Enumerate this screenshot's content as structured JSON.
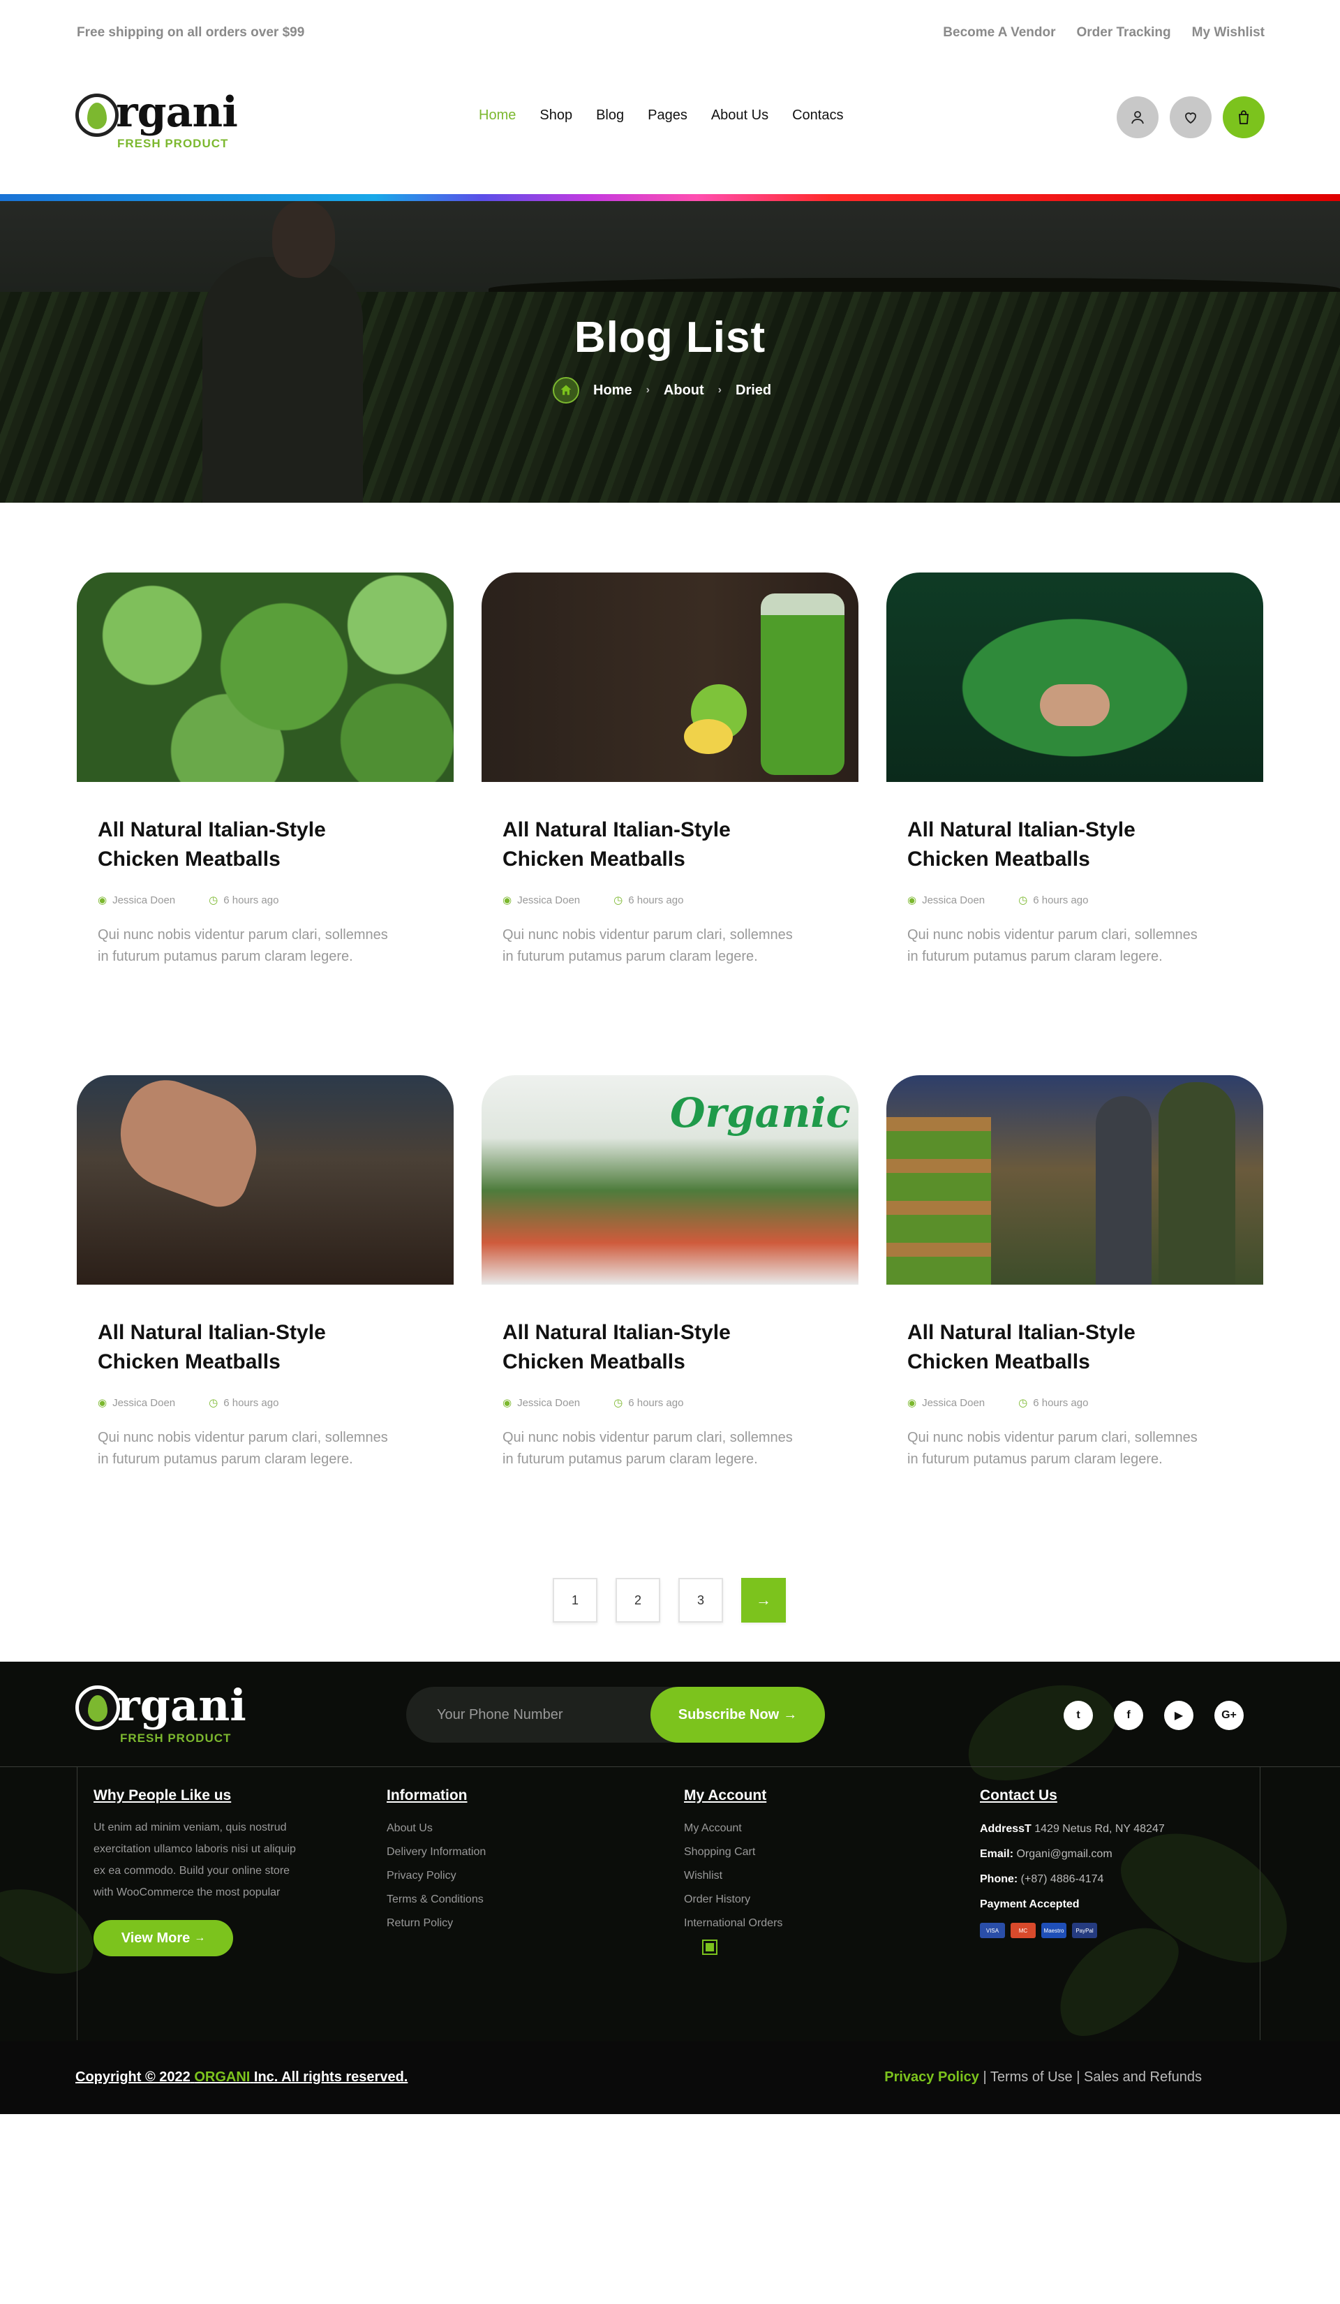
{
  "topbar": {
    "promo": "Free shipping on all orders over $99",
    "links": [
      "Become A Vendor",
      "Order Tracking",
      "My Wishlist"
    ]
  },
  "brand": {
    "name": "rgani",
    "first_letter": "O",
    "tagline": "FRESH PRODUCT"
  },
  "nav": {
    "items": [
      "Home",
      "Shop",
      "Blog",
      "Pages",
      "About Us",
      "Contacs"
    ],
    "active": "Home"
  },
  "header_icons": [
    "user-icon",
    "heart-icon",
    "shopping-bag-icon"
  ],
  "hero": {
    "title": "Blog List",
    "breadcrumb": [
      "Home",
      "About",
      "Dried"
    ]
  },
  "posts": [
    {
      "title": "All Natural Italian-Style Chicken Meatballs",
      "author": "Jessica Doen",
      "time": "6 hours ago",
      "excerpt": "Qui nunc nobis videntur parum clari, sollemnes in futurum putamus parum claram legere."
    },
    {
      "title": "All Natural Italian-Style Chicken Meatballs",
      "author": "Jessica Doen",
      "time": "6 hours ago",
      "excerpt": "Qui nunc nobis videntur parum clari, sollemnes in futurum putamus parum claram legere."
    },
    {
      "title": "All Natural Italian-Style Chicken Meatballs",
      "author": "Jessica Doen",
      "time": "6 hours ago",
      "excerpt": "Qui nunc nobis videntur parum clari, sollemnes in futurum putamus parum claram legere."
    },
    {
      "title": "All Natural Italian-Style Chicken Meatballs",
      "author": "Jessica Doen",
      "time": "6 hours ago",
      "excerpt": "Qui nunc nobis videntur parum clari, sollemnes in futurum putamus parum claram legere."
    },
    {
      "title": "All Natural Italian-Style Chicken Meatballs",
      "author": "Jessica Doen",
      "time": "6 hours ago",
      "excerpt": "Qui nunc nobis videntur parum clari, sollemnes in futurum putamus parum claram legere."
    },
    {
      "title": "All Natural Italian-Style Chicken Meatballs",
      "author": "Jessica Doen",
      "time": "6 hours ago",
      "excerpt": "Qui nunc nobis videntur parum clari, sollemnes in futurum putamus parum claram legere."
    }
  ],
  "post_images": [
    "mint-leaves-photo",
    "green-smoothie-photo",
    "spinach-bunch-photo",
    "soil-seeding-photo",
    "organic-supermarket-photo",
    "warehouse-workers-photo"
  ],
  "organic_sign": "Organic",
  "pagination": {
    "pages": [
      "1",
      "2",
      "3"
    ],
    "next": "→"
  },
  "footer": {
    "subscribe": {
      "placeholder": "Your Phone Number",
      "button": "Subscribe Now"
    },
    "social": [
      "twitter-icon",
      "facebook-icon",
      "youtube-icon",
      "google-plus-icon"
    ],
    "social_glyphs": [
      "t",
      "f",
      "▶",
      "G+"
    ],
    "why": {
      "heading": "Why People Like us",
      "text": "Ut enim ad minim veniam, quis nostrud exercitation ullamco laboris nisi ut aliquip ex ea commodo. Build your online store with WooCommerce the most popular",
      "button": "View More"
    },
    "information": {
      "heading": "Information",
      "items": [
        "About Us",
        "Delivery Information",
        "Privacy Policy",
        "Terms & Conditions",
        "Return Policy"
      ]
    },
    "account": {
      "heading": "My Account",
      "items": [
        "My Account",
        "Shopping Cart",
        "Wishlist",
        "Order History",
        "International Orders"
      ]
    },
    "contact": {
      "heading": "Contact Us",
      "address_label": "AddressT",
      "address": "1429 Netus Rd, NY 48247",
      "email_label": "Email:",
      "email": "Organi@gmail.com",
      "phone_label": "Phone:",
      "phone": "(+87) 4886-4174",
      "payment_label": "Payment Accepted",
      "payment_methods": [
        "VISA",
        "MC",
        "Maestro",
        "PayPal"
      ]
    },
    "copyright_prefix": "Copyright © 2022",
    "copyright_brand": "ORGANI",
    "copyright_suffix": "Inc. All rights reserved.",
    "legal": [
      "Privacy Policy",
      "Terms of Use",
      "Sales and Refunds"
    ]
  },
  "colors": {
    "accent": "#7cc31d",
    "footer_bg": "#0b0d0a",
    "text_dark": "#111111",
    "muted": "#999999"
  }
}
